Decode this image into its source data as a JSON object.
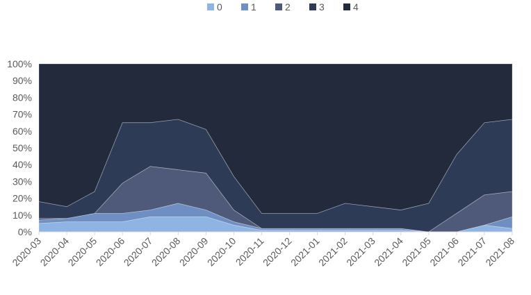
{
  "chart_data": {
    "type": "area",
    "stacked": "percent",
    "title": "",
    "xlabel": "",
    "ylabel": "",
    "ylim": [
      0,
      100
    ],
    "yticks": [
      0,
      10,
      20,
      30,
      40,
      50,
      60,
      70,
      80,
      90,
      100
    ],
    "ytick_labels": [
      "0%",
      "10%",
      "20%",
      "30%",
      "40%",
      "50%",
      "60%",
      "70%",
      "80%",
      "90%",
      "100%"
    ],
    "grid": false,
    "legend_position": "top-center",
    "categories": [
      "2020-03",
      "2020-04",
      "2020-05",
      "2020-06",
      "2020-07",
      "2020-08",
      "2020-09",
      "2020-10",
      "2020-11",
      "2020-12",
      "2021-01",
      "2021-02",
      "2021-03",
      "2021-04",
      "2021-05",
      "2021-06",
      "2021-07",
      "2021-08"
    ],
    "series": [
      {
        "name": "0",
        "color": "#8db4e2",
        "values": [
          5,
          6,
          6,
          6,
          9,
          9,
          9,
          4,
          1,
          1,
          1,
          1,
          1,
          1,
          0,
          0,
          4,
          2
        ]
      },
      {
        "name": "1",
        "color": "#6f8fc3",
        "values": [
          2,
          2,
          5,
          5,
          4,
          8,
          4,
          2,
          1,
          1,
          1,
          1,
          1,
          1,
          0,
          0,
          0,
          7
        ]
      },
      {
        "name": "2",
        "color": "#4f5a7a",
        "values": [
          1,
          0,
          0,
          18,
          26,
          20,
          22,
          7,
          0,
          0,
          0,
          0,
          0,
          0,
          0,
          11,
          18,
          15
        ]
      },
      {
        "name": "3",
        "color": "#2e3b57",
        "values": [
          10,
          7,
          13,
          36,
          26,
          30,
          26,
          20,
          9,
          9,
          9,
          15,
          13,
          11,
          17,
          35,
          43,
          43
        ]
      },
      {
        "name": "4",
        "color": "#222a3c",
        "values": [
          82,
          85,
          76,
          35,
          35,
          33,
          39,
          67,
          89,
          89,
          89,
          83,
          85,
          87,
          83,
          54,
          35,
          33
        ]
      }
    ]
  }
}
